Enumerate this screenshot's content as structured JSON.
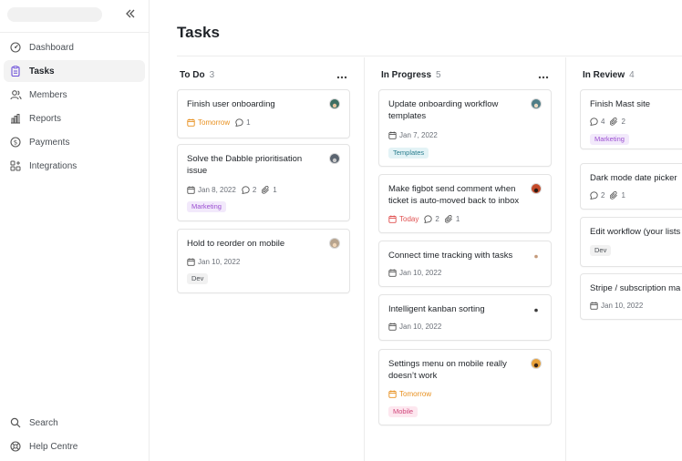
{
  "sidebar": {
    "items": [
      {
        "label": "Dashboard",
        "icon": "dashboard-icon"
      },
      {
        "label": "Tasks",
        "icon": "clipboard-icon",
        "active": true
      },
      {
        "label": "Members",
        "icon": "members-icon"
      },
      {
        "label": "Reports",
        "icon": "chart-icon"
      },
      {
        "label": "Payments",
        "icon": "dollar-icon"
      },
      {
        "label": "Integrations",
        "icon": "integrations-icon"
      }
    ],
    "bottom": [
      {
        "label": "Search",
        "icon": "search-icon"
      },
      {
        "label": "Help Centre",
        "icon": "help-icon"
      }
    ]
  },
  "page": {
    "title": "Tasks"
  },
  "columns": [
    {
      "name": "To Do",
      "count": "3",
      "cards": [
        {
          "title": "Finish user onboarding",
          "date": "Tomorrow",
          "comments": "1"
        },
        {
          "title": "Solve the Dabble prioritisation issue",
          "date": "Jan 8, 2022",
          "comments": "2",
          "attachments": "1",
          "tag": "Marketing"
        },
        {
          "title": "Hold to reorder on mobile",
          "date": "Jan 10, 2022",
          "tag": "Dev"
        }
      ]
    },
    {
      "name": "In Progress",
      "count": "5",
      "cards": [
        {
          "title": "Update onboarding workflow templates",
          "date": "Jan 7, 2022",
          "tag": "Templates"
        },
        {
          "title": "Make figbot send comment when ticket is auto-moved back to inbox",
          "date": "Today",
          "comments": "2",
          "attachments": "1"
        },
        {
          "title": "Connect time tracking with tasks",
          "date": "Jan 10, 2022"
        },
        {
          "title": "Intelligent kanban sorting",
          "date": "Jan 10, 2022"
        },
        {
          "title": "Settings menu on mobile really doesn’t work",
          "date": "Tomorrow",
          "tag": "Mobile"
        }
      ]
    },
    {
      "name": "In Review",
      "count": "4",
      "cards": [
        {
          "title": "Finish Mast site",
          "comments": "4",
          "attachments": "2",
          "tag": "Marketing"
        },
        {
          "title": "Dark mode date picker",
          "comments": "2",
          "attachments": "1"
        },
        {
          "title": "Edit workflow (your lists",
          "tag": "Dev"
        },
        {
          "title": "Stripe / subscription ma",
          "date": "Jan 10, 2022"
        }
      ]
    }
  ],
  "colors": {
    "accent_active_icon": "#6b4fd8",
    "overdue_orange": "#e8901f",
    "today_red": "#e05050",
    "tag_marketing_bg": "#f2e9fb",
    "tag_marketing_fg": "#9b4fd1",
    "tag_dev_bg": "#f1f1f1",
    "tag_dev_fg": "#4a4f55",
    "tag_templates_bg": "#e3f3f6",
    "tag_templates_fg": "#2a7e8e",
    "tag_mobile_bg": "#fde7ef",
    "tag_mobile_fg": "#d0457a"
  }
}
